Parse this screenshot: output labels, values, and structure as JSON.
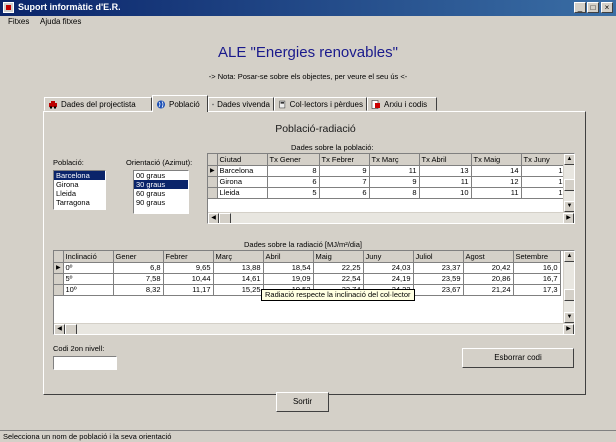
{
  "window": {
    "title": "Suport informàtic d'E.R.",
    "controls": [
      "_",
      "□",
      "×"
    ]
  },
  "menu": [
    "Fitxes",
    "Ajuda fitxes"
  ],
  "heading": "ALE \"Energies renovables\"",
  "note": "-> Nota: Posar-se sobre els objectes, per veure el seu ús <-",
  "tabs": [
    {
      "label": "Dades del projectista",
      "icon": "car-icon",
      "active": false
    },
    {
      "label": "Població",
      "icon": "globe-icon",
      "active": true
    },
    {
      "label": "Dades vivenda",
      "icon": "keyboard-icon",
      "active": false
    },
    {
      "label": "Col·lectors i pèrdues",
      "icon": "calculator-icon",
      "active": false
    },
    {
      "label": "Arxiu i codis",
      "icon": "document-icon",
      "active": false
    }
  ],
  "panel": {
    "title": "Població-radiació",
    "poblacio_label": "Població:",
    "orientacio_label": "Orientació (Azimut):",
    "poblacio_options": [
      "Barcelona",
      "Girona",
      "Lleida",
      "Tarragona"
    ],
    "poblacio_selected": "Barcelona",
    "orientacio_options": [
      "00 graus",
      "30 graus",
      "60 graus",
      "90 graus"
    ],
    "orientacio_selected": "30 graus",
    "poblacio_grid_caption": "Dades sobre la població:",
    "poblacio_grid": {
      "columns": [
        "Ciutad",
        "Tx Gener",
        "Tx Febrer",
        "Tx Març",
        "Tx Abril",
        "Tx Maig",
        "Tx Juny"
      ],
      "rows": [
        [
          "Barcelona",
          "8",
          "9",
          "11",
          "13",
          "14",
          "1"
        ],
        [
          "Girona",
          "6",
          "7",
          "9",
          "11",
          "12",
          "1"
        ],
        [
          "Lleida",
          "5",
          "6",
          "8",
          "10",
          "11",
          "1"
        ]
      ]
    },
    "radiacio_grid_caption": "Dades sobre la radiació [MJ/m²/dia]",
    "radiacio_grid": {
      "columns": [
        "Inclinació",
        "Gener",
        "Febrer",
        "Març",
        "Abril",
        "Maig",
        "Juny",
        "Juliol",
        "Agost",
        "Setembre"
      ],
      "rows": [
        [
          "0º",
          "6,8",
          "9,65",
          "13,88",
          "18,54",
          "22,25",
          "24,03",
          "23,37",
          "20,42",
          "16,0"
        ],
        [
          "5º",
          "7,58",
          "10,44",
          "14,61",
          "19,09",
          "22,54",
          "24,19",
          "23,59",
          "20,86",
          "16,7"
        ],
        [
          "10º",
          "8,32",
          "11,17",
          "15,25",
          "19,52",
          "22,74",
          "24,22",
          "23,67",
          "21,24",
          "17,3"
        ]
      ]
    },
    "tooltip": "Radiació respecte la inclinació del col·lector",
    "codi_label": "Codi 2on nivell:",
    "codi_value": "",
    "esborrar_button": "Esborrar codi"
  },
  "sortir_button": "Sortir",
  "status": "Selecciona un nom de població i la seva orientació"
}
